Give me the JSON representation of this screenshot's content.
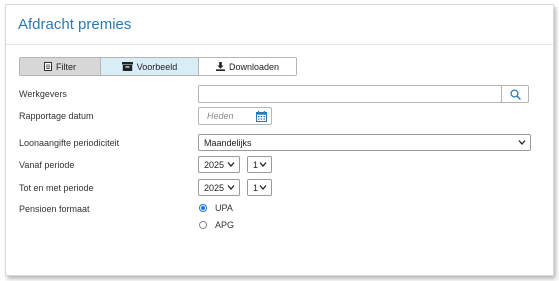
{
  "page": {
    "title": "Afdracht premies"
  },
  "toolbar": {
    "filter_label": "Filter",
    "voorbeeld_label": "Voorbeeld",
    "downloaden_label": "Downloaden"
  },
  "form": {
    "werkgevers": {
      "label": "Werkgevers",
      "value": ""
    },
    "rapportage_datum": {
      "label": "Rapportage datum",
      "placeholder": "Heden"
    },
    "periodiciteit": {
      "label": "Loonaangifte periodiciteit",
      "value": "Maandelijks"
    },
    "vanaf": {
      "label": "Vanaf periode",
      "year": "2025",
      "period": "1"
    },
    "tot": {
      "label": "Tot en met periode",
      "year": "2025",
      "period": "1"
    },
    "pensioen": {
      "label": "Pensioen formaat",
      "options": [
        "UPA",
        "APG"
      ],
      "selected": "UPA"
    }
  },
  "colors": {
    "title": "#2d7ab3",
    "accent": "#1a73e8",
    "voorbeeld_bg": "#d9edf7"
  }
}
